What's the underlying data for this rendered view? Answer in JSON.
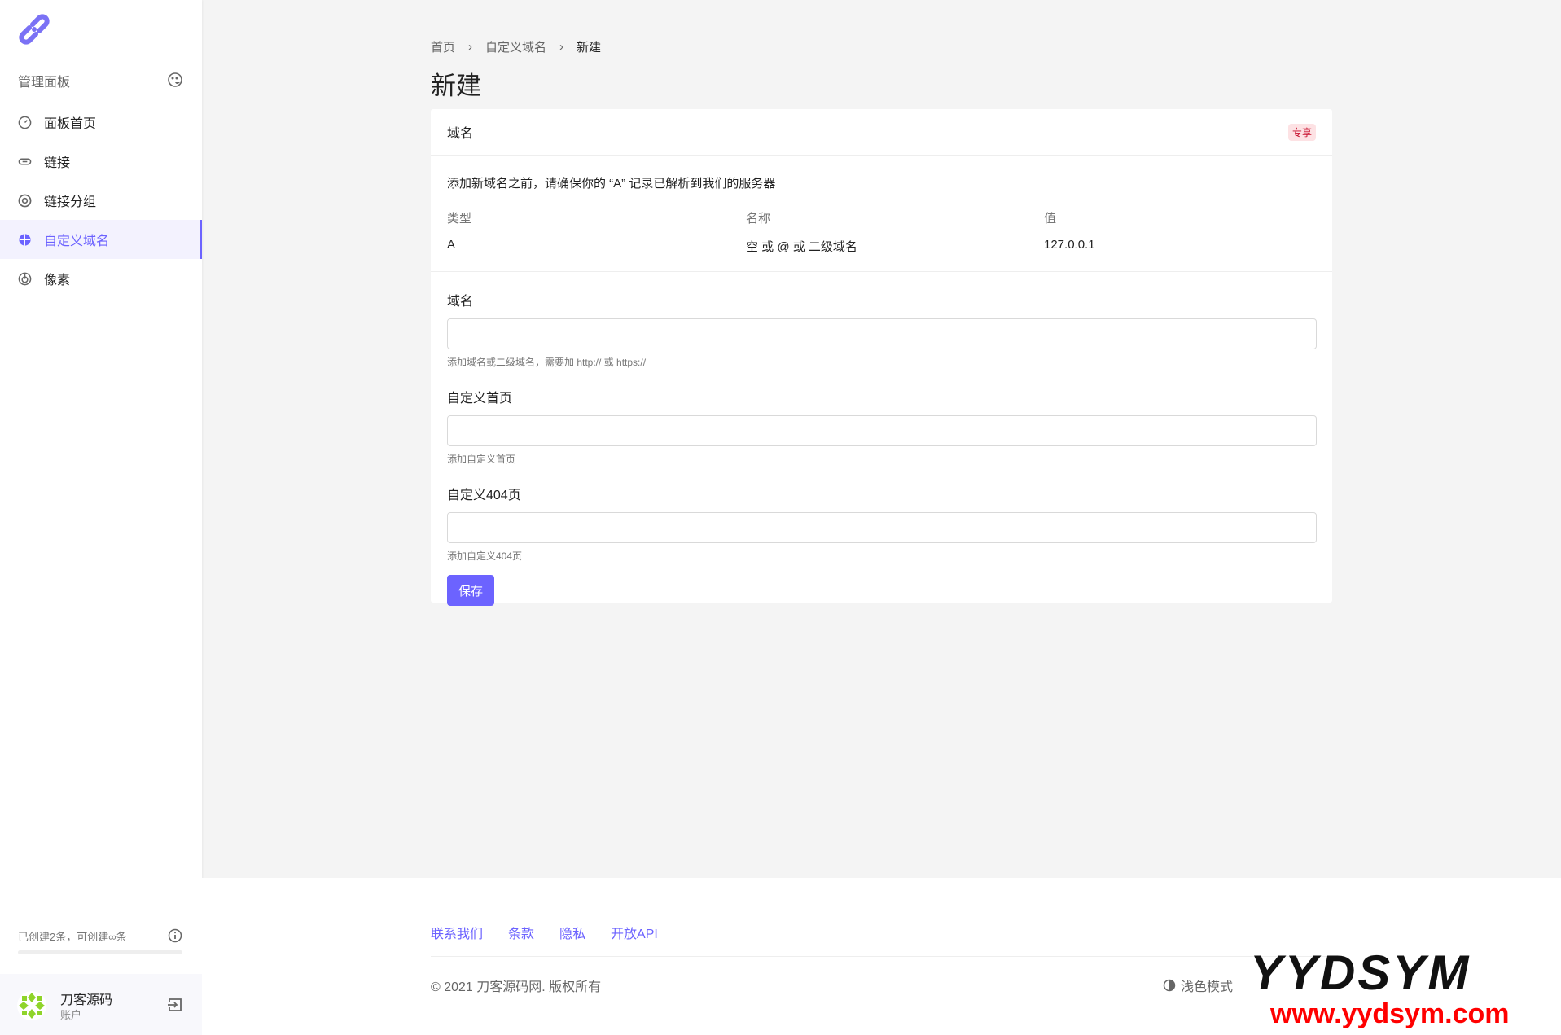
{
  "sidebar": {
    "panel_title": "管理面板",
    "menu": [
      {
        "label": "面板首页",
        "icon": "dashboard-icon"
      },
      {
        "label": "链接",
        "icon": "link-icon"
      },
      {
        "label": "链接分组",
        "icon": "target-icon"
      },
      {
        "label": "自定义域名",
        "icon": "globe-icon",
        "active": true
      },
      {
        "label": "像素",
        "icon": "pixel-icon"
      }
    ],
    "quota": "已创建2条，可创建∞条",
    "quota_progress": 0,
    "user": {
      "name": "刀客源码",
      "role": "账户"
    }
  },
  "breadcrumb": [
    "首页",
    "自定义域名",
    "新建"
  ],
  "page_title": "新建",
  "card": {
    "header": "域名",
    "badge": "专享",
    "notice": "添加新域名之前，请确保你的 “A” 记录已解析到我们的服务器",
    "table": {
      "headers": [
        "类型",
        "名称",
        "值"
      ],
      "values": [
        "A",
        "空 或 @ 或 二级域名",
        "127.0.0.1"
      ]
    },
    "fields": [
      {
        "label": "域名",
        "value": "",
        "help": "添加域名或二级域名，需要加 http:// 或 https://"
      },
      {
        "label": "自定义首页",
        "value": "",
        "help": "添加自定义首页"
      },
      {
        "label": "自定义404页",
        "value": "",
        "help": "添加自定义404页"
      }
    ],
    "save": "保存"
  },
  "footer": {
    "links": [
      "联系我们",
      "条款",
      "隐私",
      "开放API"
    ],
    "copyright": "© 2021 刀客源码网. 版权所有",
    "theme": "浅色模式"
  },
  "watermark": {
    "line1": "YYDSYM",
    "line2": "www.yydsym.com"
  },
  "colors": {
    "accent": "#6c63ff",
    "badge": "#c8102e"
  }
}
